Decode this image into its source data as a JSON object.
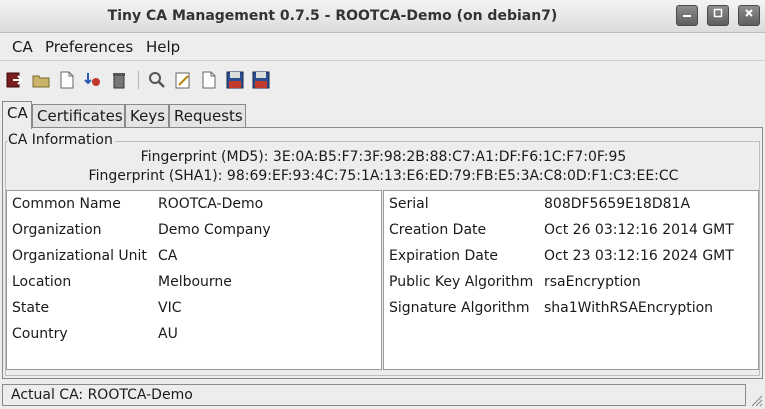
{
  "window": {
    "title": "Tiny CA Management 0.7.5 - ROOTCA-Demo (on debian7)"
  },
  "menu": [
    "CA",
    "Preferences",
    "Help"
  ],
  "toolbar": {
    "icons": [
      "exit-icon",
      "open-ca-icon",
      "new-ca-icon",
      "import-ca-icon",
      "delete-ca-icon",
      "view-icon",
      "edit-icon",
      "new-doc-icon",
      "export-icon",
      "export-crl-icon"
    ]
  },
  "tabs": [
    "CA",
    "Certificates",
    "Keys",
    "Requests"
  ],
  "ca_info": {
    "group_title": "CA Information",
    "fingerprint_md5": "Fingerprint (MD5): 3E:0A:B5:F7:3F:98:2B:88:C7:A1:DF:F6:1C:F7:0F:95",
    "fingerprint_sha1": "Fingerprint (SHA1): 98:69:EF:93:4C:75:1A:13:E6:ED:79:FB:E5:3A:C8:0D:F1:C3:EE:CC",
    "left": [
      {
        "label": "Common Name",
        "value": "ROOTCA-Demo"
      },
      {
        "label": "Organization",
        "value": "Demo Company"
      },
      {
        "label": "Organizational Unit",
        "value": "CA"
      },
      {
        "label": "Location",
        "value": "Melbourne"
      },
      {
        "label": "State",
        "value": "VIC"
      },
      {
        "label": "Country",
        "value": "AU"
      }
    ],
    "right": [
      {
        "label": "Serial",
        "value": "808DF5659E18D81A"
      },
      {
        "label": "Creation Date",
        "value": "Oct 26 03:12:16 2014 GMT"
      },
      {
        "label": "Expiration Date",
        "value": "Oct 23 03:12:16 2024 GMT"
      },
      {
        "label": "Public Key Algorithm",
        "value": "rsaEncryption"
      },
      {
        "label": "Signature Algorithm",
        "value": "sha1WithRSAEncryption"
      }
    ]
  },
  "status": {
    "text": "Actual CA: ROOTCA-Demo"
  }
}
